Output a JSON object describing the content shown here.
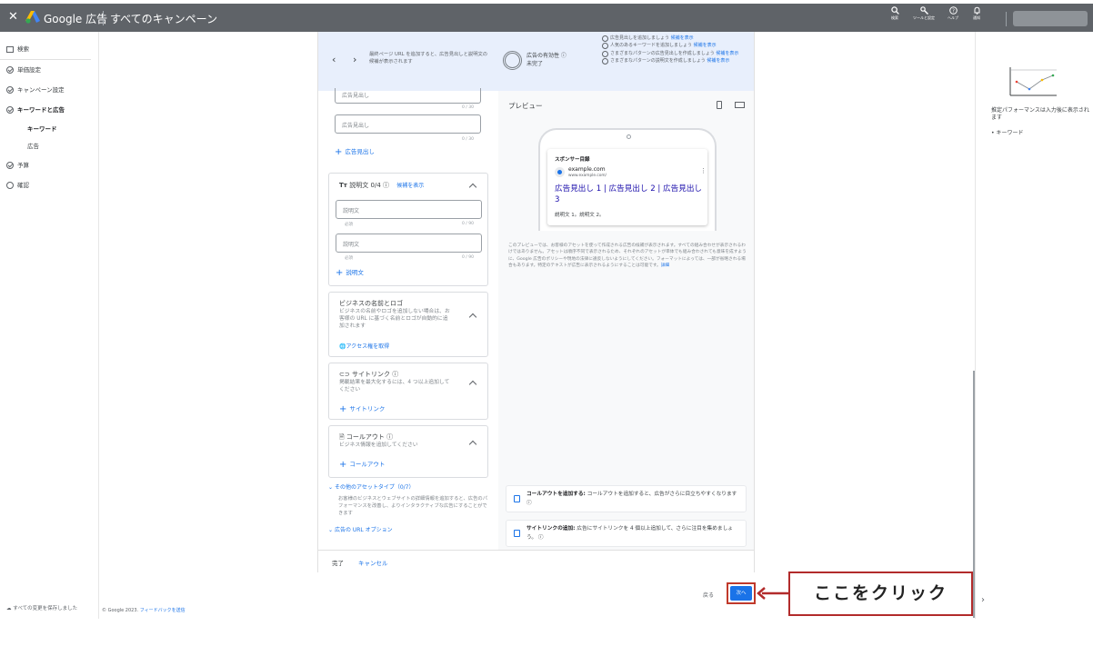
{
  "topbar": {
    "close": "✕",
    "brand": "Google 広告",
    "title": "すべてのキャンペーン",
    "icons": [
      {
        "name": "search-icon",
        "label": "検索"
      },
      {
        "name": "tools-icon",
        "label": "ツールと設定"
      },
      {
        "name": "help-icon",
        "label": "ヘルプ"
      },
      {
        "name": "notifications-icon",
        "label": "通知"
      }
    ]
  },
  "sidenav": {
    "top_item": "検索",
    "steps": [
      {
        "label": "単価設定",
        "state": "done"
      },
      {
        "label": "キャンペーン設定",
        "state": "done"
      },
      {
        "label": "キーワードと広告",
        "state": "current"
      },
      {
        "label": "予算",
        "state": "done"
      },
      {
        "label": "確認",
        "state": "todo"
      }
    ],
    "subitems": [
      "キーワード",
      "広告"
    ],
    "save_status": "すべての変更を保存しました"
  },
  "banner": {
    "tip": "最終ページ URL を追加すると、広告見出しと説明文の候補が表示されます",
    "effectiveness_label": "広告の有効性 ⓘ",
    "effectiveness_value": "未完了",
    "suggestions": [
      {
        "text": "広告見出しを追加しましょう",
        "link": "候補を表示"
      },
      {
        "text": "人気のあるキーワードを追加しましょう",
        "link": "候補を表示"
      },
      {
        "text": "さまざまなパターンの広告見出しを作成しましょう",
        "link": "候補を表示"
      },
      {
        "text": "さまざまなパターンの説明文を作成しましょう",
        "link": "候補を表示"
      }
    ]
  },
  "headlines": {
    "field1_placeholder": "広告見出し",
    "field1_count": "0 / 30",
    "field2_placeholder": "広告見出し",
    "field2_count": "0 / 30",
    "add_label": "広告見出し"
  },
  "descriptions": {
    "title": "説明文 0/4 ⓘ",
    "suggestions_link": "候補を表示",
    "field1_placeholder": "説明文",
    "field1_req": "必須",
    "field1_count": "0 / 90",
    "field2_placeholder": "説明文",
    "field2_req": "必須",
    "field2_count": "0 / 90",
    "add_label": "説明文"
  },
  "business": {
    "title": "ビジネスの名前とロゴ",
    "desc": "ビジネスの名前やロゴを追加しない場合は、お客様の URL に基づく名前とロゴが自動的に追加されます",
    "access_link": "アクセス権を取得"
  },
  "sitelinks": {
    "title": "サイトリンク ⓘ",
    "desc": "掲載結果を最大化するには、4 つ以上追加してください",
    "add_label": "サイトリンク"
  },
  "callouts": {
    "title": "コールアウト ⓘ",
    "desc": "ビジネス情報を追加してください",
    "add_label": "コールアウト"
  },
  "other_assets": {
    "label": "その他のアセットタイプ（0/7）",
    "desc": "お客様のビジネスとウェブサイトの詳細情報を追加すると、広告のパフォーマンスを改善し、よりインタラクティブな広告にすることができます",
    "url_options": "広告の URL オプション"
  },
  "preview": {
    "title": "プレビュー",
    "sponsor": "スポンサー目録",
    "domain": "example.com",
    "url": "www.example.com/",
    "headline": "広告見出し 1 | 広告見出し 2 | 広告見出し 3",
    "description": "説明文 1。説明文 2。",
    "note": "このプレビューでは、お客様のアセットを使って作成される広告の候補が表示されます。すべての組み合わせが表示されるわけではありません。アセットは順序不同で表示されるため、それぞれのアセットが単体でも組み合わされても意味を成すように、Google 広告のポリシーや現地の法律に違反しないようにしてください。フォーマットによっては、一部が省略される場合もあります。特定のテキストが広告に表示されるようにすることは可能です。",
    "note_link": "詳細"
  },
  "tips": [
    {
      "bold": "コールアウトを追加する:",
      "text": " コールアウトを追加すると、広告がさらに目立ちやすくなります ⓘ"
    },
    {
      "bold": "サイトリンクの追加:",
      "text": " 広告にサイトリンクを 4 個以上追加して、さらに注目を集めましょう。 ⓘ"
    }
  ],
  "panel_footer": {
    "done": "完了",
    "cancel": "キャンセル"
  },
  "right_panel": {
    "text": "推定パフォーマンスは入力後に表示されます",
    "bullet": "キーワード"
  },
  "footer": {
    "copyright": "© Google 2023.",
    "feedback": "フィードバックを送信",
    "back": "戻る",
    "next": "次へ",
    "callout": "ここをクリック"
  }
}
